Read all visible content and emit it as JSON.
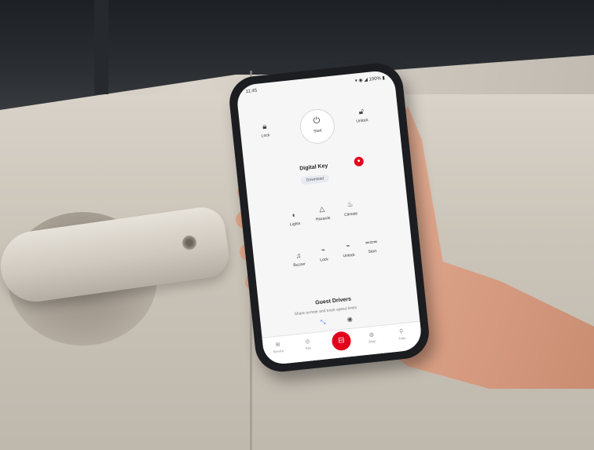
{
  "phone": {
    "status": {
      "time": "11:45",
      "right": "▾ ◉ ◢ 100% ▮"
    },
    "top_controls": {
      "lock_icon": "lock-icon",
      "lock": "Lock",
      "start_icon": "power-icon",
      "start": "Start",
      "unlock_icon": "unlock-icon",
      "unlock": "Unlock"
    },
    "digital_key": {
      "title": "Digital Key",
      "button": "Download",
      "badge": "●"
    },
    "remote_grid": [
      {
        "label": "Lights",
        "icon": "◐"
      },
      {
        "label": "Hazards",
        "icon": "△"
      },
      {
        "label": "Climate",
        "icon": "♨"
      },
      {
        "label": "Buzzer",
        "icon": "♫"
      },
      {
        "label": "Lock",
        "icon": "⌁"
      },
      {
        "label": "Unlock",
        "icon": "⌁"
      },
      {
        "label": "Start",
        "icon": "⩶"
      }
    ],
    "guest_drivers": {
      "title": "Guest Drivers",
      "subtitle": "Share remote and track speed limits",
      "icon1": "⤡",
      "icon2": "◉"
    },
    "nav": [
      {
        "label": "Service",
        "icon": "⊞"
      },
      {
        "label": "Pay",
        "icon": "◎"
      },
      {
        "label": "",
        "icon": "⊟"
      },
      {
        "label": "Shop",
        "icon": "◍"
      },
      {
        "label": "Trips",
        "icon": "⚲"
      }
    ]
  }
}
